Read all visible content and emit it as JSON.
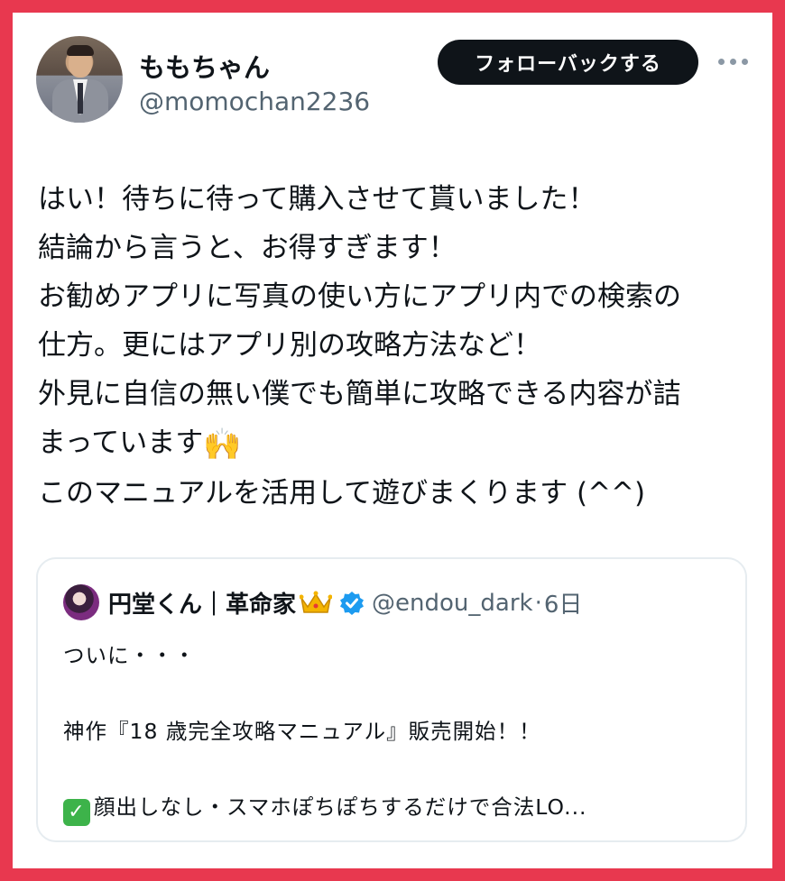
{
  "user": {
    "display_name": "ももちゃん",
    "handle": "@momochan2236"
  },
  "follow_button_label": "フォローバックする",
  "icons": {
    "more": "more-horizontal-icon",
    "verified": "verified-badge-icon",
    "crown": "crown-emoji",
    "raising_hands": "raising-hands-emoji",
    "check": "check-mark-emoji"
  },
  "tweet_lines": [
    "はい！待ちに待って購入させて貰いました！",
    "結論から言うと、お得すぎます！",
    "お勧めアプリに写真の使い方にアプリ内での検索の",
    "仕方。更にはアプリ別の攻略方法など！",
    "外見に自信の無い僕でも簡単に攻略できる内容が詰",
    "まっています",
    "このマニュアルを活用して遊びまくります (^^)"
  ],
  "hands_emoji": "🙌",
  "quote": {
    "name": "円堂くん｜革命家",
    "handle": "@endou_dark",
    "separator": "·",
    "time": "6日",
    "lines": [
      "ついに・・・",
      "",
      "神作『18 歳完全攻略マニュアル』販売開始！！",
      "",
      "顔出しなし・スマホぽちぽちするだけで合法LO..."
    ],
    "check_emoji": "✓"
  },
  "colors": {
    "frame": "#e8384f",
    "text": "#0f1419",
    "secondary": "#536471",
    "button_bg": "#0f1419",
    "verified": "#1d9bf0",
    "border": "#e6ecf0"
  }
}
